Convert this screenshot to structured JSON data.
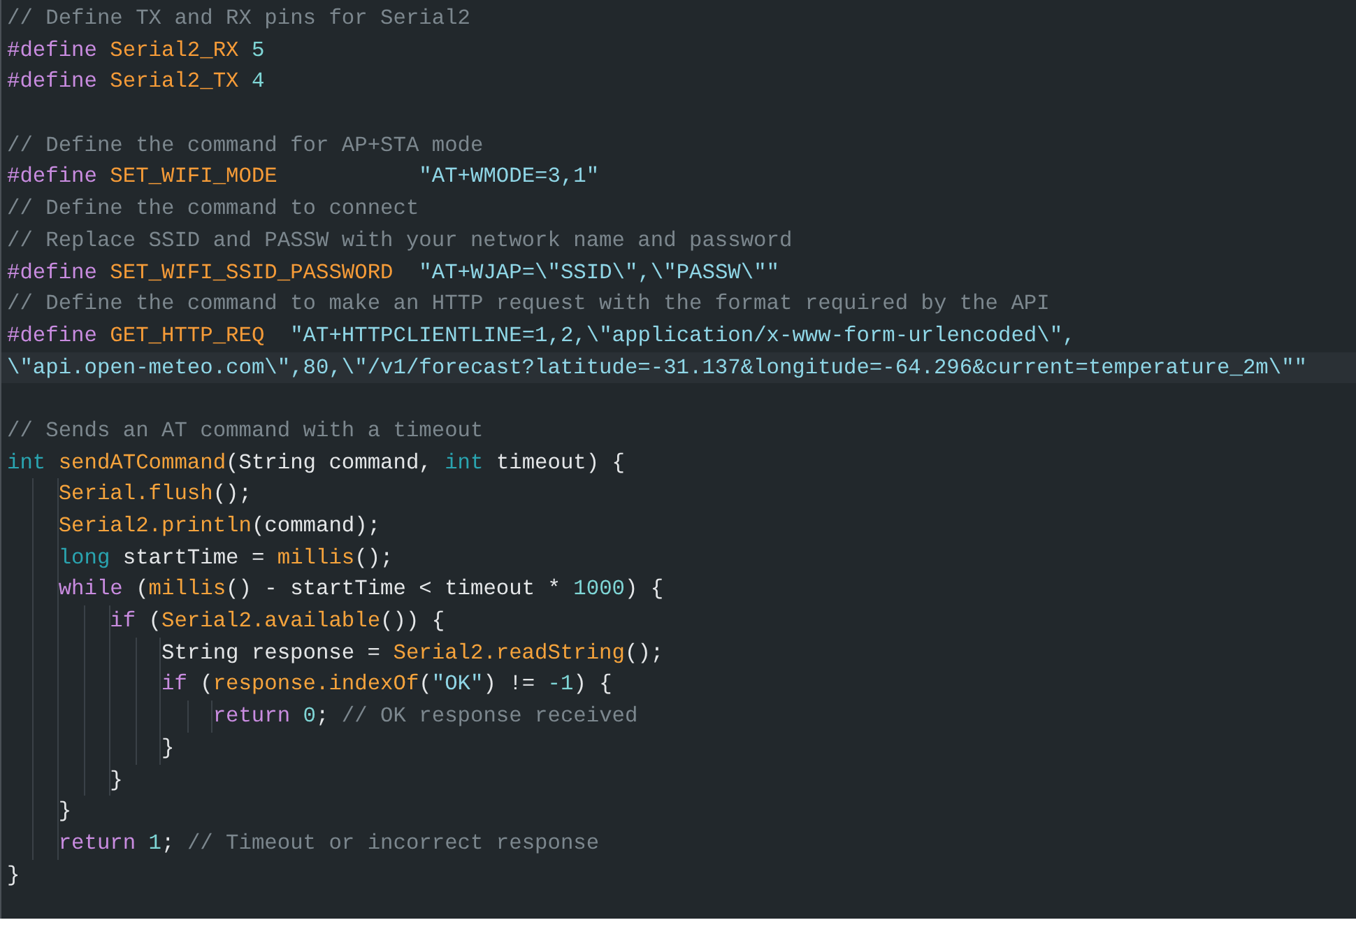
{
  "editor": {
    "lines": [
      {
        "kind": "code",
        "tokens": [
          {
            "kind": "comment",
            "text": "// Define TX and RX pins for Serial2"
          }
        ]
      },
      {
        "kind": "code",
        "tokens": [
          {
            "kind": "directive",
            "text": "#define "
          },
          {
            "kind": "macro",
            "text": "Serial2_RX "
          },
          {
            "kind": "number",
            "text": "5"
          }
        ]
      },
      {
        "kind": "code",
        "tokens": [
          {
            "kind": "directive",
            "text": "#define "
          },
          {
            "kind": "macro",
            "text": "Serial2_TX "
          },
          {
            "kind": "number",
            "text": "4"
          }
        ]
      },
      {
        "kind": "blank"
      },
      {
        "kind": "code",
        "tokens": [
          {
            "kind": "comment",
            "text": "// Define the command for AP+STA mode"
          }
        ]
      },
      {
        "kind": "code",
        "tokens": [
          {
            "kind": "directive",
            "text": "#define "
          },
          {
            "kind": "macro",
            "text": "SET_WIFI_MODE           "
          },
          {
            "kind": "string",
            "text": "\"AT+WMODE=3,1\""
          }
        ]
      },
      {
        "kind": "code",
        "tokens": [
          {
            "kind": "comment",
            "text": "// Define the command to connect"
          }
        ]
      },
      {
        "kind": "code",
        "tokens": [
          {
            "kind": "comment",
            "text": "// Replace SSID and PASSW with your network name and password"
          }
        ]
      },
      {
        "kind": "code",
        "tokens": [
          {
            "kind": "directive",
            "text": "#define "
          },
          {
            "kind": "macro",
            "text": "SET_WIFI_SSID_PASSWORD  "
          },
          {
            "kind": "string",
            "text": "\"AT+WJAP=\\\"SSID\\\",\\\"PASSW\\\"\""
          }
        ]
      },
      {
        "kind": "code",
        "tokens": [
          {
            "kind": "comment",
            "text": "// Define the command to make an HTTP request with the format required by the API"
          }
        ]
      },
      {
        "kind": "code",
        "tokens": [
          {
            "kind": "directive",
            "text": "#define "
          },
          {
            "kind": "macro",
            "text": "GET_HTTP_REQ  "
          },
          {
            "kind": "string",
            "text": "\"AT+HTTPCLIENTLINE=1,2,\\\"application/x-www-form-urlencoded\\\","
          }
        ]
      },
      {
        "kind": "code",
        "current": true,
        "tokens": [
          {
            "kind": "string",
            "text": "\\\"api.open-meteo.com\\\",80,\\\"/v1/forecast?latitude=-31.137&longitude=-64.296&current=temperature_2m\\\"\""
          }
        ]
      },
      {
        "kind": "blank"
      },
      {
        "kind": "code",
        "tokens": [
          {
            "kind": "comment",
            "text": "// Sends an AT command with a timeout"
          }
        ]
      },
      {
        "kind": "code",
        "tokens": [
          {
            "kind": "type",
            "text": "int "
          },
          {
            "kind": "function",
            "text": "sendATCommand"
          },
          {
            "kind": "plain",
            "text": "(String command, "
          },
          {
            "kind": "type",
            "text": "int "
          },
          {
            "kind": "plain",
            "text": "timeout) {"
          }
        ],
        "children": [
          {
            "kind": "code",
            "tokens": [
              {
                "kind": "function",
                "text": "Serial.flush"
              },
              {
                "kind": "plain",
                "text": "();"
              }
            ]
          },
          {
            "kind": "code",
            "tokens": [
              {
                "kind": "function",
                "text": "Serial2.println"
              },
              {
                "kind": "plain",
                "text": "(command);"
              }
            ]
          },
          {
            "kind": "code",
            "tokens": [
              {
                "kind": "type",
                "text": "long "
              },
              {
                "kind": "plain",
                "text": "startTime = "
              },
              {
                "kind": "function",
                "text": "millis"
              },
              {
                "kind": "plain",
                "text": "();"
              }
            ]
          },
          {
            "kind": "code",
            "tokens": [
              {
                "kind": "keyword",
                "text": "while "
              },
              {
                "kind": "plain",
                "text": "("
              },
              {
                "kind": "function",
                "text": "millis"
              },
              {
                "kind": "plain",
                "text": "() - startTime < timeout * "
              },
              {
                "kind": "number",
                "text": "1000"
              },
              {
                "kind": "plain",
                "text": ") {"
              }
            ],
            "children": [
              {
                "kind": "code",
                "tokens": [
                  {
                    "kind": "keyword",
                    "text": "if "
                  },
                  {
                    "kind": "plain",
                    "text": "("
                  },
                  {
                    "kind": "function",
                    "text": "Serial2.available"
                  },
                  {
                    "kind": "plain",
                    "text": "()) {"
                  }
                ],
                "children": [
                  {
                    "kind": "code",
                    "tokens": [
                      {
                        "kind": "plain",
                        "text": "String response = "
                      },
                      {
                        "kind": "function",
                        "text": "Serial2.readString"
                      },
                      {
                        "kind": "plain",
                        "text": "();"
                      }
                    ]
                  },
                  {
                    "kind": "code",
                    "tokens": [
                      {
                        "kind": "keyword",
                        "text": "if "
                      },
                      {
                        "kind": "plain",
                        "text": "("
                      },
                      {
                        "kind": "function",
                        "text": "response.indexOf"
                      },
                      {
                        "kind": "plain",
                        "text": "("
                      },
                      {
                        "kind": "string",
                        "text": "\"OK\""
                      },
                      {
                        "kind": "plain",
                        "text": ") != "
                      },
                      {
                        "kind": "number",
                        "text": "-1"
                      },
                      {
                        "kind": "plain",
                        "text": ") {"
                      }
                    ],
                    "children": [
                      {
                        "kind": "code",
                        "tokens": [
                          {
                            "kind": "keyword",
                            "text": "return "
                          },
                          {
                            "kind": "number",
                            "text": "0"
                          },
                          {
                            "kind": "plain",
                            "text": "; "
                          },
                          {
                            "kind": "comment",
                            "text": "// OK response received"
                          }
                        ]
                      }
                    ],
                    "closing": "}"
                  }
                ],
                "closing": "}"
              }
            ],
            "closing": "}"
          },
          {
            "kind": "code",
            "tokens": [
              {
                "kind": "keyword",
                "text": "return "
              },
              {
                "kind": "number",
                "text": "1"
              },
              {
                "kind": "plain",
                "text": "; "
              },
              {
                "kind": "comment",
                "text": "// Timeout or incorrect response"
              }
            ]
          }
        ],
        "closing": "}"
      }
    ]
  }
}
